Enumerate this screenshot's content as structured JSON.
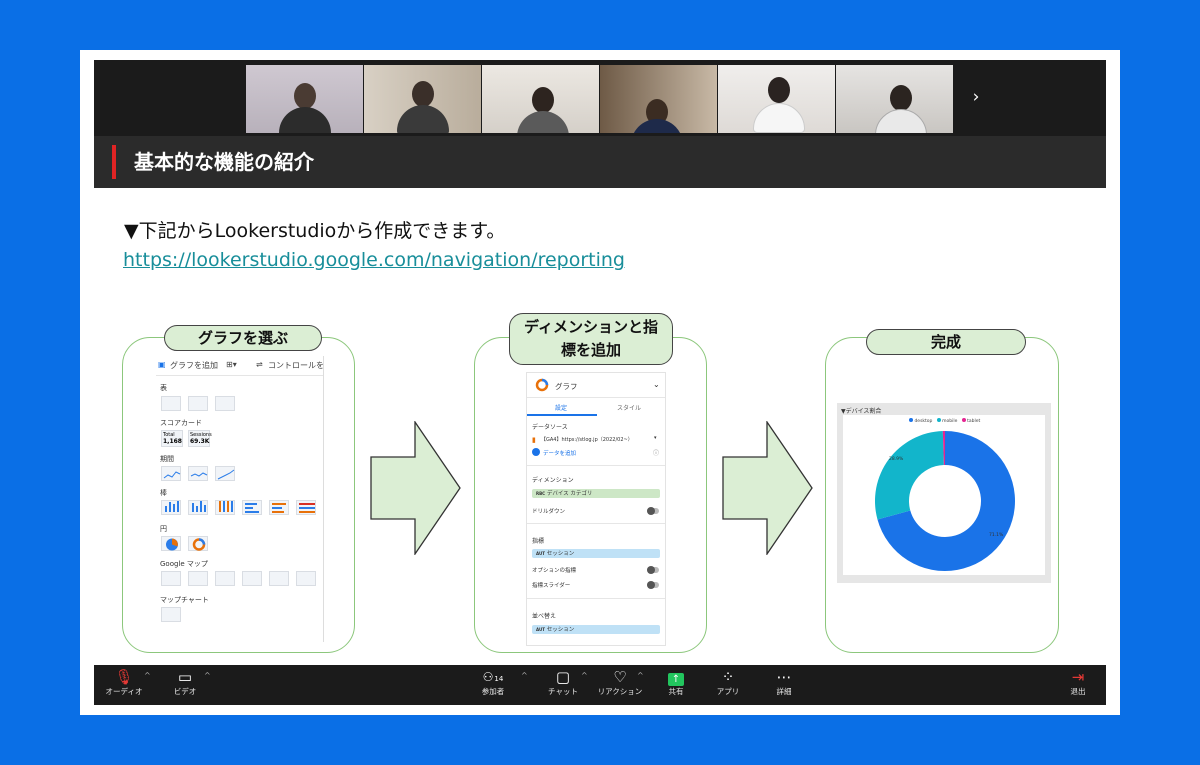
{
  "slide": {
    "title": "基本的な機能の紹介",
    "intro_text": "▼下記からLookerstudioから作成できます。",
    "link_text": "https://lookerstudio.google.com/navigation/reporting"
  },
  "steps": [
    {
      "label": "グラフを選ぶ"
    },
    {
      "label_line1": "ディメンションと指",
      "label_line2": "標を追加"
    },
    {
      "label": "完成"
    }
  ],
  "picker": {
    "add_chart": "グラフを追加",
    "controls": "コントロールを",
    "sections": [
      "表",
      "スコアカード",
      "期間",
      "棒",
      "円",
      "Google マップ",
      "マップチャート"
    ],
    "scorecards": [
      {
        "label": "Total",
        "value": "1,168"
      },
      {
        "label": "Sessions",
        "value": "69.3K"
      }
    ]
  },
  "config": {
    "chart_name": "グラフ",
    "tab_setup": "設定",
    "tab_style": "スタイル",
    "data_source_label": "データソース",
    "data_source_value": "【GA4】https://stlog.jp（2022/02~）",
    "add_data": "データを追加",
    "dimension_label": "ディメンション",
    "dimension_chip": "デバイス カテゴリ",
    "drilldown": "ドリルダウン",
    "metric_label": "指標",
    "metric_chip": "セッション",
    "optional_metric": "オプションの指標",
    "metric_slider": "指標スライダー",
    "sort_label": "並べ替え",
    "sort_chip": "セッション",
    "chip_prefix": "RBC",
    "chip_prefix_metric": "AUT"
  },
  "result": {
    "chart_title": "▼デバイス割合",
    "legend": [
      "desktop",
      "mobile",
      "tablet"
    ],
    "label_mobile": "28.9%",
    "label_desktop": "71.1%"
  },
  "chart_data": {
    "type": "pie",
    "title": "▼デバイス割合",
    "categories": [
      "desktop",
      "mobile",
      "tablet"
    ],
    "values": [
      71.1,
      28.9,
      0.5
    ],
    "colors": [
      "#1a73e8",
      "#12b5cb",
      "#e52592"
    ]
  },
  "toolbar": {
    "audio": "オーディオ",
    "video": "ビデオ",
    "participants_count": "14",
    "participants": "参加者",
    "chat": "チャット",
    "reaction": "リアクション",
    "share": "共有",
    "apps": "アプリ",
    "more": "詳細",
    "leave": "退出"
  },
  "colors": {
    "background": "#0a6fe6",
    "accent_red": "#e02424",
    "link": "#188e9a",
    "step_fill": "#dbeed4",
    "share_green": "#22c55e"
  }
}
